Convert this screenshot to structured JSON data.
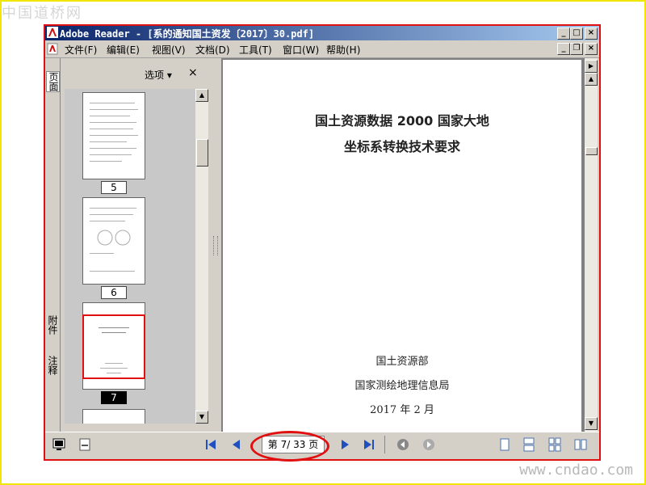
{
  "watermarks": {
    "top_left": "中国道桥网",
    "bottom_right": "www.cndao.com"
  },
  "window": {
    "title": "Adobe Reader - [系的通知国土资发〔2017〕30.pdf]",
    "controls": [
      "minimize",
      "maximize",
      "close"
    ],
    "doc_controls": [
      "minimize",
      "restore",
      "close"
    ]
  },
  "menu": [
    {
      "label": "文件(F)"
    },
    {
      "label": "编辑(E)"
    },
    {
      "label": "视图(V)"
    },
    {
      "label": "文档(D)"
    },
    {
      "label": "工具(T)"
    },
    {
      "label": "窗口(W)"
    },
    {
      "label": "帮助(H)"
    }
  ],
  "side_tabs": {
    "pages": "页面",
    "attachments": "附件",
    "comments": "注释"
  },
  "panel": {
    "options_label": "选项",
    "close_label": "×"
  },
  "thumbnails": [
    {
      "page": "5"
    },
    {
      "page": "6"
    },
    {
      "page": "7",
      "selected": true
    }
  ],
  "document": {
    "title_line1": "国土资源数据 2000 国家大地",
    "title_line2": "坐标系转换技术要求",
    "issuer1": "国土资源部",
    "issuer2": "国家测绘地理信息局",
    "date": "2017 年 2 月"
  },
  "status": {
    "page_indicator": "第 7/ 33 页"
  },
  "colors": {
    "highlight": "#e01010",
    "titlebar_start": "#0a246a",
    "titlebar_end": "#a6caf0",
    "frame": "#f2e600"
  }
}
